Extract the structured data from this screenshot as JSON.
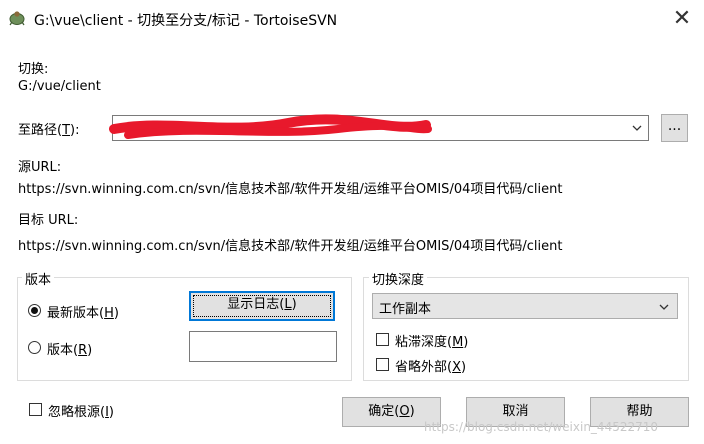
{
  "window": {
    "title": "G:\\vue\\client - 切换至分支/标记 - TortoiseSVN",
    "close_glyph": "✕"
  },
  "switch": {
    "label": "切换:",
    "path": "G:/vue/client"
  },
  "to_path": {
    "label_prefix": "至路径(",
    "label_key": "T",
    "label_suffix": "):",
    "browse_label": "..."
  },
  "source_url": {
    "label": "源URL:",
    "value": "https://svn.winning.com.cn/svn/信息技术部/软件开发组/运维平台OMIS/04项目代码/client"
  },
  "target_url": {
    "label": "目标 URL:",
    "value": "https://svn.winning.com.cn/svn/信息技术部/软件开发组/运维平台OMIS/04项目代码/client"
  },
  "revision": {
    "group_title": "版本",
    "head_prefix": "最新版本(",
    "head_key": "H",
    "head_suffix": ")",
    "head_selected": true,
    "rev_prefix": "版本(",
    "rev_key": "R",
    "rev_suffix": ")",
    "rev_selected": false,
    "rev_value": "",
    "show_log_prefix": "显示日志(",
    "show_log_key": "L",
    "show_log_suffix": ")"
  },
  "depth": {
    "group_title": "切换深度",
    "selected": "工作副本",
    "sticky_prefix": "粘滞深度(",
    "sticky_key": "M",
    "sticky_suffix": ")",
    "sticky_checked": false,
    "omit_prefix": "省略外部(",
    "omit_key": "X",
    "omit_suffix": ")",
    "omit_checked": false
  },
  "ignore_ancestry": {
    "prefix": "忽略根源(",
    "key": "I",
    "suffix": ")",
    "checked": false
  },
  "buttons": {
    "ok_prefix": "确定(",
    "ok_key": "O",
    "ok_suffix": ")",
    "cancel": "取消",
    "help": "帮助"
  },
  "watermark": "https://blog.csdn.net/weixin_44522710",
  "colors": {
    "accent": "#0078d7",
    "redaction": "#e8192c"
  }
}
